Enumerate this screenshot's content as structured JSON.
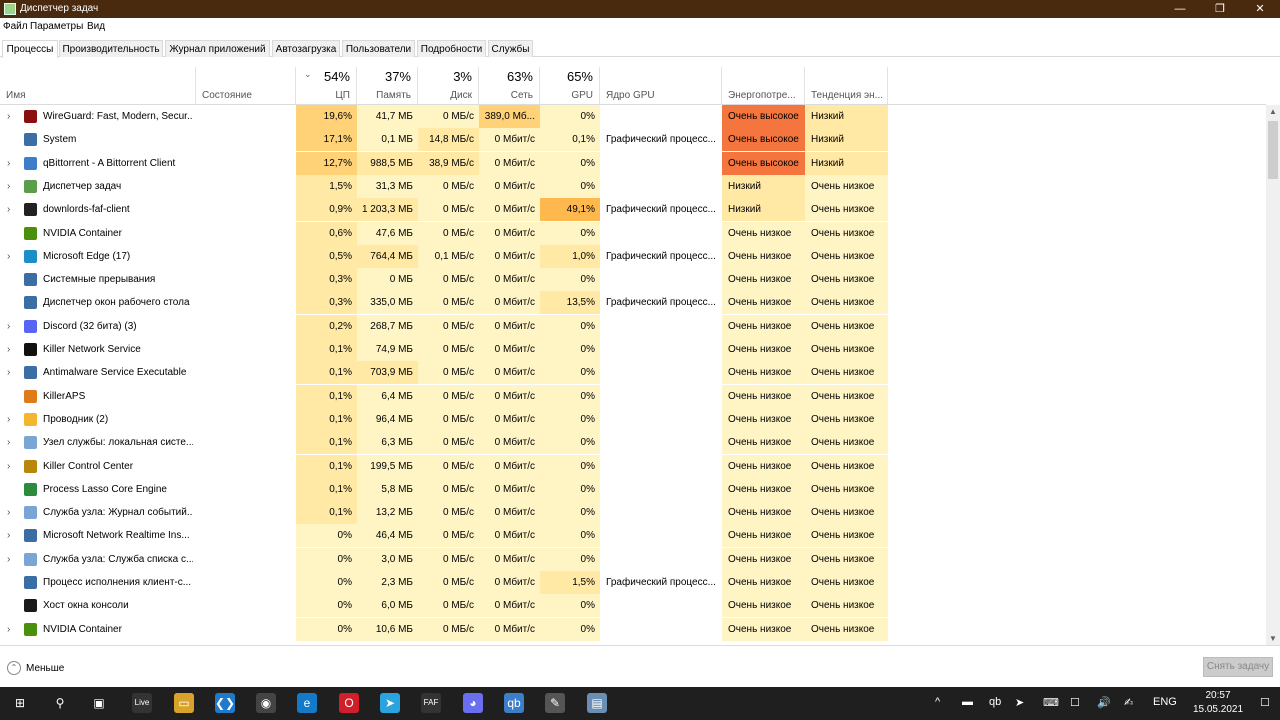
{
  "window": {
    "title": "Диспетчер задач",
    "minimize_glyph": "—",
    "maximize_glyph": "❐",
    "close_glyph": "✕"
  },
  "menu": [
    "Файл",
    "Параметры",
    "Вид"
  ],
  "tabs": [
    "Процессы",
    "Производительность",
    "Журнал приложений",
    "Автозагрузка",
    "Пользователи",
    "Подробности",
    "Службы"
  ],
  "columns": {
    "name": "Имя",
    "status": "Состояние",
    "cpu": {
      "pct": "54%",
      "label": "ЦП"
    },
    "mem": {
      "pct": "37%",
      "label": "Память"
    },
    "disk": {
      "pct": "3%",
      "label": "Диск"
    },
    "net": {
      "pct": "63%",
      "label": "Сеть"
    },
    "gpu": {
      "pct": "65%",
      "label": "GPU"
    },
    "gpu_engine": "Ядро GPU",
    "power": "Энергопотре...",
    "power_trend": "Тенденция эн..."
  },
  "processes": [
    {
      "name": "WireGuard: Fast, Modern, Secur...",
      "expand": true,
      "icon": "wireguard-icon",
      "icon_color": "#8a1010",
      "cpu": "19,6%",
      "mem": "41,7 МБ",
      "disk": "0 МБ/с",
      "net": "389,0 Мб...",
      "gpu": "0%",
      "engine": "",
      "power": "Очень высокое",
      "trend": "Низкий"
    },
    {
      "name": "System",
      "expand": false,
      "icon": "system-icon",
      "icon_color": "#3a6ea5",
      "cpu": "17,1%",
      "mem": "0,1 МБ",
      "disk": "14,8 МБ/с",
      "net": "0 Мбит/с",
      "gpu": "0,1%",
      "engine": "Графический процесс...",
      "power": "Очень высокое",
      "trend": "Низкий"
    },
    {
      "name": "qBittorrent - A Bittorrent Client",
      "expand": true,
      "icon": "qbittorrent-icon",
      "icon_color": "#3d7ecb",
      "cpu": "12,7%",
      "mem": "988,5 МБ",
      "disk": "38,9 МБ/с",
      "net": "0 Мбит/с",
      "gpu": "0%",
      "engine": "",
      "power": "Очень высокое",
      "trend": "Низкий"
    },
    {
      "name": "Диспетчер задач",
      "expand": true,
      "icon": "task-manager-icon",
      "icon_color": "#5a9e4a",
      "cpu": "1,5%",
      "mem": "31,3 МБ",
      "disk": "0 МБ/с",
      "net": "0 Мбит/с",
      "gpu": "0%",
      "engine": "",
      "power": "Низкий",
      "trend": "Очень низкое"
    },
    {
      "name": "downlords-faf-client",
      "expand": true,
      "icon": "faf-client-icon",
      "icon_color": "#222222",
      "cpu": "0,9%",
      "mem": "1 203,3 МБ",
      "disk": "0 МБ/с",
      "net": "0 Мбит/с",
      "gpu": "49,1%",
      "engine": "Графический процесс...",
      "power": "Низкий",
      "trend": "Очень низкое"
    },
    {
      "name": "NVIDIA Container",
      "expand": false,
      "icon": "nvidia-icon",
      "icon_color": "#4b8f0f",
      "cpu": "0,6%",
      "mem": "47,6 МБ",
      "disk": "0 МБ/с",
      "net": "0 Мбит/с",
      "gpu": "0%",
      "engine": "",
      "power": "Очень низкое",
      "trend": "Очень низкое"
    },
    {
      "name": "Microsoft Edge (17)",
      "expand": true,
      "icon": "edge-icon",
      "icon_color": "#1a8fc9",
      "cpu": "0,5%",
      "mem": "764,4 МБ",
      "disk": "0,1 МБ/с",
      "net": "0 Мбит/с",
      "gpu": "1,0%",
      "engine": "Графический процесс...",
      "power": "Очень низкое",
      "trend": "Очень низкое"
    },
    {
      "name": "Системные прерывания",
      "expand": false,
      "icon": "interrupts-icon",
      "icon_color": "#3a6ea5",
      "cpu": "0,3%",
      "mem": "0 МБ",
      "disk": "0 МБ/с",
      "net": "0 Мбит/с",
      "gpu": "0%",
      "engine": "",
      "power": "Очень низкое",
      "trend": "Очень низкое"
    },
    {
      "name": "Диспетчер окон рабочего стола",
      "expand": false,
      "icon": "dwm-icon",
      "icon_color": "#3a6ea5",
      "cpu": "0,3%",
      "mem": "335,0 МБ",
      "disk": "0 МБ/с",
      "net": "0 Мбит/с",
      "gpu": "13,5%",
      "engine": "Графический процесс...",
      "power": "Очень низкое",
      "trend": "Очень низкое"
    },
    {
      "name": "Discord (32 бита) (3)",
      "expand": true,
      "icon": "discord-icon",
      "icon_color": "#5865f2",
      "cpu": "0,2%",
      "mem": "268,7 МБ",
      "disk": "0 МБ/с",
      "net": "0 Мбит/с",
      "gpu": "0%",
      "engine": "",
      "power": "Очень низкое",
      "trend": "Очень низкое"
    },
    {
      "name": "Killer Network Service",
      "expand": true,
      "icon": "killer-network-icon",
      "icon_color": "#111111",
      "cpu": "0,1%",
      "mem": "74,9 МБ",
      "disk": "0 МБ/с",
      "net": "0 Мбит/с",
      "gpu": "0%",
      "engine": "",
      "power": "Очень низкое",
      "trend": "Очень низкое"
    },
    {
      "name": "Antimalware Service Executable",
      "expand": true,
      "icon": "antimalware-icon",
      "icon_color": "#3a6ea5",
      "cpu": "0,1%",
      "mem": "703,9 МБ",
      "disk": "0 МБ/с",
      "net": "0 Мбит/с",
      "gpu": "0%",
      "engine": "",
      "power": "Очень низкое",
      "trend": "Очень низкое"
    },
    {
      "name": "KillerAPS",
      "expand": false,
      "icon": "killeraps-icon",
      "icon_color": "#e07b1a",
      "cpu": "0,1%",
      "mem": "6,4 МБ",
      "disk": "0 МБ/с",
      "net": "0 Мбит/с",
      "gpu": "0%",
      "engine": "",
      "power": "Очень низкое",
      "trend": "Очень низкое"
    },
    {
      "name": "Проводник (2)",
      "expand": true,
      "icon": "explorer-icon",
      "icon_color": "#f2b632",
      "cpu": "0,1%",
      "mem": "96,4 МБ",
      "disk": "0 МБ/с",
      "net": "0 Мбит/с",
      "gpu": "0%",
      "engine": "",
      "power": "Очень низкое",
      "trend": "Очень низкое"
    },
    {
      "name": "Узел службы: локальная систе...",
      "expand": true,
      "icon": "service-host-icon",
      "icon_color": "#7aa6d6",
      "cpu": "0,1%",
      "mem": "6,3 МБ",
      "disk": "0 МБ/с",
      "net": "0 Мбит/с",
      "gpu": "0%",
      "engine": "",
      "power": "Очень низкое",
      "trend": "Очень низкое"
    },
    {
      "name": "Killer Control Center",
      "expand": true,
      "icon": "killer-control-icon",
      "icon_color": "#b8860b",
      "cpu": "0,1%",
      "mem": "199,5 МБ",
      "disk": "0 МБ/с",
      "net": "0 Мбит/с",
      "gpu": "0%",
      "engine": "",
      "power": "Очень низкое",
      "trend": "Очень низкое"
    },
    {
      "name": "Process Lasso Core Engine",
      "expand": false,
      "icon": "process-lasso-icon",
      "icon_color": "#2e8b3d",
      "cpu": "0,1%",
      "mem": "5,8 МБ",
      "disk": "0 МБ/с",
      "net": "0 Мбит/с",
      "gpu": "0%",
      "engine": "",
      "power": "Очень низкое",
      "trend": "Очень низкое"
    },
    {
      "name": "Служба узла: Журнал событий...",
      "expand": true,
      "icon": "service-host-icon",
      "icon_color": "#7aa6d6",
      "cpu": "0,1%",
      "mem": "13,2 МБ",
      "disk": "0 МБ/с",
      "net": "0 Мбит/с",
      "gpu": "0%",
      "engine": "",
      "power": "Очень низкое",
      "trend": "Очень низкое"
    },
    {
      "name": "Microsoft Network Realtime Ins...",
      "expand": true,
      "icon": "network-realtime-icon",
      "icon_color": "#3a6ea5",
      "cpu": "0%",
      "mem": "46,4 МБ",
      "disk": "0 МБ/с",
      "net": "0 Мбит/с",
      "gpu": "0%",
      "engine": "",
      "power": "Очень низкое",
      "trend": "Очень низкое"
    },
    {
      "name": "Служба узла: Служба списка с...",
      "expand": true,
      "icon": "service-host-icon",
      "icon_color": "#7aa6d6",
      "cpu": "0%",
      "mem": "3,0 МБ",
      "disk": "0 МБ/с",
      "net": "0 Мбит/с",
      "gpu": "0%",
      "engine": "",
      "power": "Очень низкое",
      "trend": "Очень низкое"
    },
    {
      "name": "Процесс исполнения клиент-с...",
      "expand": false,
      "icon": "csrss-icon",
      "icon_color": "#3a6ea5",
      "cpu": "0%",
      "mem": "2,3 МБ",
      "disk": "0 МБ/с",
      "net": "0 Мбит/с",
      "gpu": "1,5%",
      "engine": "Графический процесс...",
      "power": "Очень низкое",
      "trend": "Очень низкое"
    },
    {
      "name": "Хост окна консоли",
      "expand": false,
      "icon": "console-host-icon",
      "icon_color": "#1a1a1a",
      "cpu": "0%",
      "mem": "6,0 МБ",
      "disk": "0 МБ/с",
      "net": "0 Мбит/с",
      "gpu": "0%",
      "engine": "",
      "power": "Очень низкое",
      "trend": "Очень низкое"
    },
    {
      "name": "NVIDIA Container",
      "expand": true,
      "icon": "nvidia-icon",
      "icon_color": "#4b8f0f",
      "cpu": "0%",
      "mem": "10,6 МБ",
      "disk": "0 МБ/с",
      "net": "0 Мбит/с",
      "gpu": "0%",
      "engine": "",
      "power": "Очень низкое",
      "trend": "Очень низкое"
    }
  ],
  "footer": {
    "fewer_details": "Меньше",
    "end_task": "Снять задачу"
  },
  "taskbar": {
    "apps": [
      {
        "name": "start-button",
        "glyph": "⊞"
      },
      {
        "name": "search-icon",
        "glyph": "⚲"
      },
      {
        "name": "task-view-icon",
        "glyph": "▣"
      },
      {
        "name": "live-icon",
        "glyph": "Live"
      },
      {
        "name": "file-explorer-icon",
        "glyph": "▭"
      },
      {
        "name": "vscode-icon",
        "glyph": "❮❯"
      },
      {
        "name": "app-icon",
        "glyph": "◉"
      },
      {
        "name": "edge-icon",
        "glyph": "e"
      },
      {
        "name": "opera-icon",
        "glyph": "O"
      },
      {
        "name": "telegram-icon",
        "glyph": "➤"
      },
      {
        "name": "faf-icon",
        "glyph": "FAF"
      },
      {
        "name": "discord-icon",
        "glyph": "◕"
      },
      {
        "name": "qbittorrent-icon",
        "glyph": "qb"
      },
      {
        "name": "tool-icon",
        "glyph": "✎"
      },
      {
        "name": "task-manager-icon",
        "glyph": "▤"
      }
    ],
    "tray": [
      "^",
      "▬",
      "qb",
      "➤",
      "⌨",
      "☐",
      "🔊",
      "✍"
    ],
    "language": "ENG",
    "time": "20:57",
    "date": "15.05.2021",
    "notification_glyph": "☐"
  },
  "colors": {
    "titlebar": "#4a2a0f",
    "heat_light": "#fff4c4",
    "heat_mid": "#ffe9a5",
    "heat_strong": "#ffd278",
    "heat_high": "#ffb84d",
    "power_very_high": "#f4753e"
  }
}
